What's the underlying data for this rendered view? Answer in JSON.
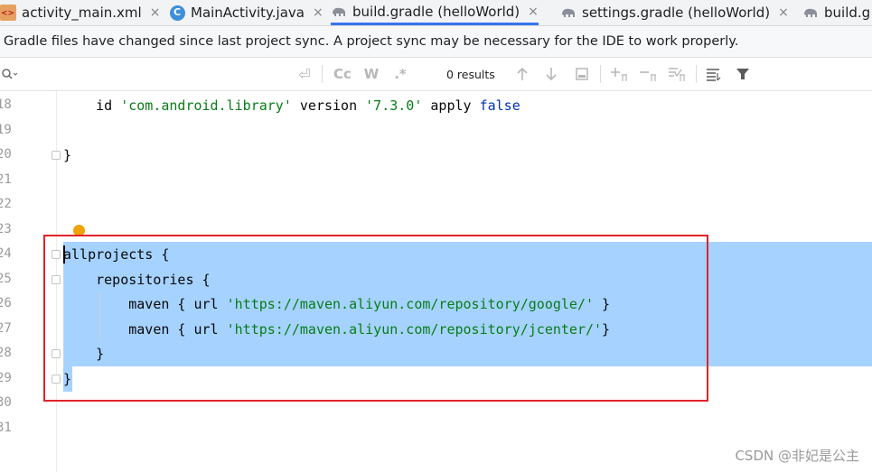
{
  "tabs": [
    {
      "label": "activity_main.xml",
      "icon": "xml-file-icon",
      "active": false,
      "close": "×"
    },
    {
      "label": "MainActivity.java",
      "icon": "java-class-icon",
      "active": false,
      "close": "×"
    },
    {
      "label": "build.gradle (helloWorld)",
      "icon": "gradle-elephant-icon",
      "active": true,
      "close": "×"
    },
    {
      "label": "settings.gradle (helloWorld)",
      "icon": "gradle-elephant-icon",
      "active": false,
      "close": "×"
    },
    {
      "label": "build.g",
      "icon": "gradle-elephant-icon",
      "active": false,
      "close": ""
    }
  ],
  "notification": {
    "text": "Gradle files have changed since last project sync. A project sync may be necessary for the IDE to work properly."
  },
  "search": {
    "query": "",
    "buttons": {
      "newline": "⏎",
      "match_case": "Cc",
      "words": "W",
      "regex": ".*"
    },
    "results": "0 results",
    "tools": [
      "up-arrow-icon",
      "down-arrow-icon",
      "select-all-icon",
      "add-occurrence-icon",
      "remove-occurrence-icon",
      "toggle-selection-icon",
      "sort-icon",
      "filter-icon"
    ]
  },
  "editor": {
    "line_numbers": [
      "18",
      "19",
      "20",
      "21",
      "22",
      "23",
      "24",
      "25",
      "26",
      "27",
      "28",
      "29",
      "30",
      "31"
    ],
    "lines": {
      "l18_pre": "    id ",
      "l18_s1": "'com.android.library'",
      "l18_mid": " version ",
      "l18_s2": "'7.3.0'",
      "l18_apply": " apply ",
      "l18_false": "false",
      "l20": "}",
      "l24": "allprojects {",
      "l25": "    repositories {",
      "l26_pre": "        maven { url ",
      "l26_str": "'https://maven.aliyun.com/repository/google/'",
      "l26_post": " }",
      "l27_pre": "        maven { url ",
      "l27_str": "'https://maven.aliyun.com/repository/jcenter/'",
      "l27_post": "}",
      "l28": "    }",
      "l29": "}"
    }
  },
  "watermark": "CSDN @非妃是公主",
  "colors": {
    "selection": "#a6d2ff",
    "highlight_box": "#e0242a",
    "string": "#067d17",
    "keyword": "#0033b3",
    "active_tab": "#3574f0"
  }
}
